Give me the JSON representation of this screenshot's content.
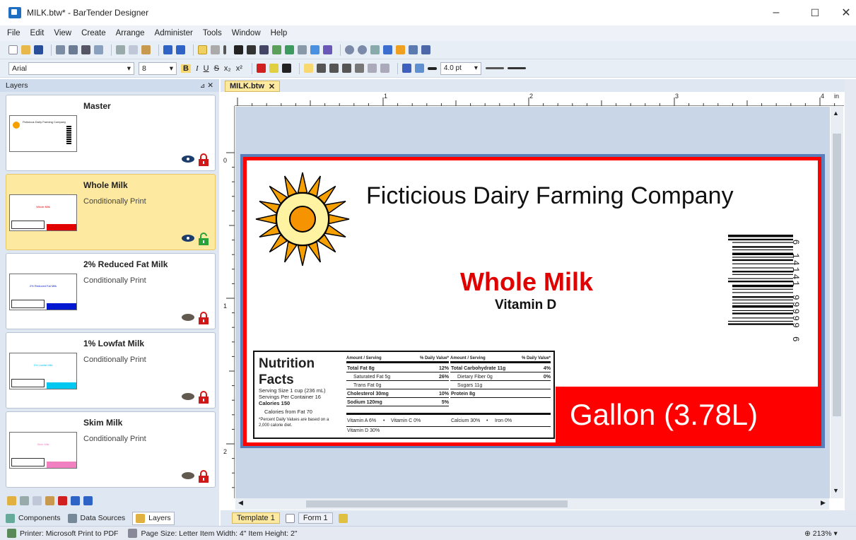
{
  "window": {
    "title": "MILK.btw* - BarTender Designer",
    "minimize": "–",
    "maximize": "☐",
    "close": "✕"
  },
  "menu": [
    "File",
    "Edit",
    "View",
    "Create",
    "Arrange",
    "Administer",
    "Tools",
    "Window",
    "Help"
  ],
  "format_toolbar": {
    "font": "Arial",
    "font_size": "8",
    "bold": "B",
    "italic": "I",
    "underline": "U",
    "strike": "S",
    "subscript": "x₂",
    "superscript": "x²",
    "line_width": "4.0 pt"
  },
  "layers_panel": {
    "title": "Layers",
    "pin": "📌",
    "close": "✕",
    "layers": [
      {
        "name": "Master",
        "subtitle": "",
        "thumb_title": "Ficticious Dairy Farming Company",
        "visible": true,
        "locked": true,
        "color": "#ffffff"
      },
      {
        "name": "Whole Milk",
        "subtitle": "Conditionally Print",
        "thumb_title": "Whole Milk",
        "visible": true,
        "locked": false,
        "color": "#e00000"
      },
      {
        "name": "2% Reduced Fat Milk",
        "subtitle": "Conditionally Print",
        "thumb_title": "2% Reduced Fat Milk",
        "visible": false,
        "locked": true,
        "color": "#0018d0"
      },
      {
        "name": "1% Lowfat Milk",
        "subtitle": "Conditionally Print",
        "thumb_title": "1% Lowfat Milk",
        "visible": false,
        "locked": true,
        "color": "#00c8f0"
      },
      {
        "name": "Skim Milk",
        "subtitle": "Conditionally Print",
        "thumb_title": "Skim Milk",
        "visible": false,
        "locked": true,
        "color": "#f080c0"
      }
    ],
    "tabs": [
      "Components",
      "Data Sources",
      "Layers"
    ]
  },
  "document": {
    "tab": "MILK.btw",
    "ruler_marks": [
      "0",
      "1",
      "2",
      "3",
      "4",
      "in"
    ],
    "company": "Ficticious Dairy Farming Company",
    "product": "Whole Milk",
    "vitamin": "Vitamin D",
    "size": "Gallon (3.78L)",
    "barcode_text": "6  14141 99999  6",
    "nutrition": {
      "title1": "Nutrition",
      "title2": "Facts",
      "serving_size": "Serving Size 1 cup (236 mL)",
      "servings": "Servings Per Container 16",
      "calories": "Calories 150",
      "calories_fat": "Calories from Fat 70",
      "footnote1": "*Percent Daily Values are based on a",
      "footnote2": "2,000 calorie diet.",
      "col_header_left": "Amount / Serving",
      "col_header_right": "% Daily Value*",
      "left_rows": [
        {
          "label": "Total Fat 8g",
          "dv": "12%"
        },
        {
          "label": "Saturated Fat 5g",
          "dv": "26%"
        },
        {
          "label": "Trans Fat 0g",
          "dv": ""
        },
        {
          "label": "Cholesterol 30mg",
          "dv": "10%"
        },
        {
          "label": "Sodium 120mg",
          "dv": "5%"
        }
      ],
      "right_rows": [
        {
          "label": "Total Carbohydrate 11g",
          "dv": "4%"
        },
        {
          "label": "Dietary Fiber 0g",
          "dv": "0%"
        },
        {
          "label": "Sugars 11g",
          "dv": ""
        },
        {
          "label": "Protein 8g",
          "dv": ""
        }
      ],
      "vitamin_a": "Vitamin A 6%",
      "vitamin_c": "Vitamin C 0%",
      "calcium": "Calcium 30%",
      "iron": "Iron 0%",
      "vitamin_d": "Vitamin D 30%"
    }
  },
  "sheet_tabs": [
    "Template 1",
    "Form 1"
  ],
  "status": {
    "printer": "Printer: Microsoft Print to PDF",
    "page": "Page Size: Letter  Item Width: 4\"  Item Height: 2\"",
    "zoom": "213%"
  }
}
